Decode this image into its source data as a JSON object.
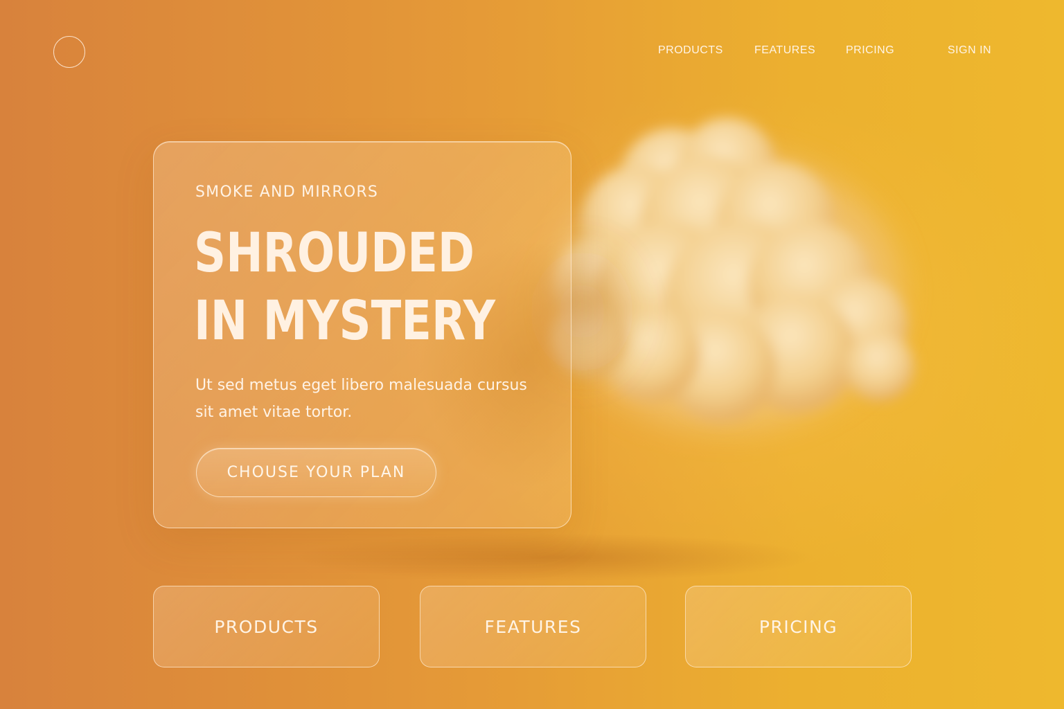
{
  "nav": {
    "links": [
      {
        "label": "PRODUCTS"
      },
      {
        "label": "FEATURES"
      },
      {
        "label": "PRICING"
      }
    ],
    "sign_in_label": "SIGN IN"
  },
  "hero": {
    "eyebrow": "SMOKE AND MIRRORS",
    "headline_line1": "SHROUDED",
    "headline_line2": "IN MYSTERY",
    "body": "Ut sed metus eget libero malesuada cursus sit amet vitae tortor.",
    "cta_label": "CHOUSE YOUR PLAN"
  },
  "tiles": [
    {
      "label": "PRODUCTS"
    },
    {
      "label": "FEATURES"
    },
    {
      "label": "PRICING"
    }
  ],
  "colors": {
    "background_start": "#d8823c",
    "background_end": "#eeb82e",
    "cloud": "#f6d9a0",
    "text": "#fff1e2"
  },
  "icons": {
    "logo": "circle-logo-icon",
    "hero_image": "smoke-cloud-icon"
  }
}
